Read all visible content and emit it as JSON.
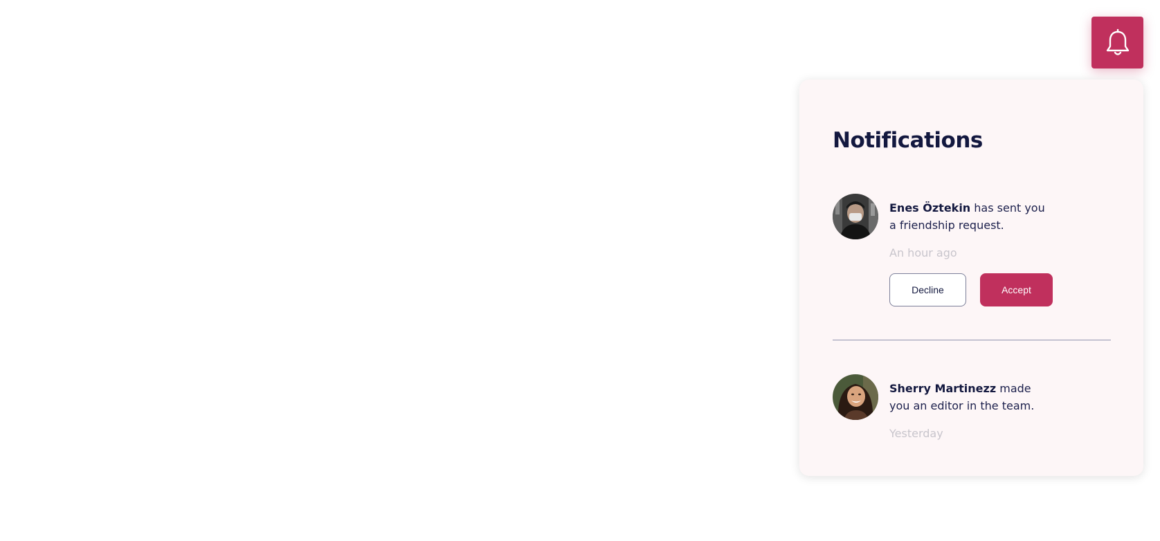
{
  "colors": {
    "accent": "#c0305d",
    "title": "#13183f",
    "panel_bg": "#fdf6f7",
    "muted": "#c8c5cc"
  },
  "bell": {
    "icon": "bell-icon"
  },
  "panel": {
    "title": "Notifications"
  },
  "notifications": [
    {
      "name": "Enes Öztekin",
      "message_line1": " has sent you",
      "message_line2": "a friendship request.",
      "time": "An hour ago",
      "avatar": "avatar-photo",
      "decline_label": "Decline",
      "accept_label": "Accept"
    },
    {
      "name": "Sherry Martinezz",
      "message_line1": " made",
      "message_line2": "you an editor in the team.",
      "time": "Yesterday",
      "avatar": "avatar-photo"
    }
  ]
}
